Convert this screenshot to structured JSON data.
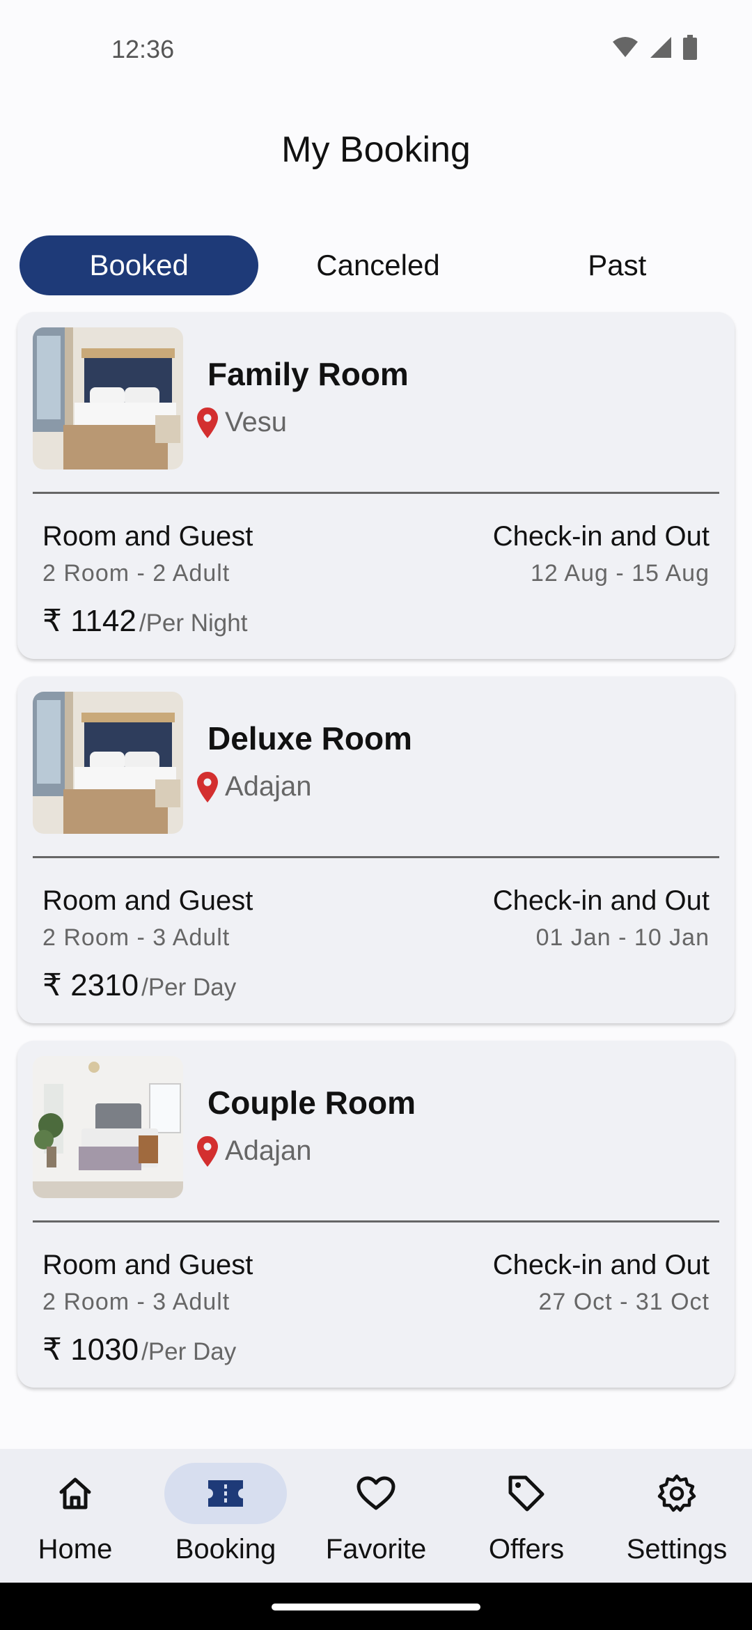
{
  "status": {
    "time": "12:36"
  },
  "header": {
    "title": "My Booking"
  },
  "tabs": [
    {
      "label": "Booked",
      "active": true
    },
    {
      "label": "Canceled",
      "active": false
    },
    {
      "label": "Past",
      "active": false
    }
  ],
  "bookings": [
    {
      "name": "Family Room",
      "location": "Vesu",
      "room_label": "Room and Guest",
      "room_value": "2 Room - 2 Adult",
      "check_label": "Check-in and Out",
      "check_value": "12 Aug - 15 Aug",
      "price": "₹ 1142",
      "price_unit": "/Per Night"
    },
    {
      "name": "Deluxe Room",
      "location": "Adajan",
      "room_label": "Room and Guest",
      "room_value": "2 Room - 3 Adult",
      "check_label": "Check-in and Out",
      "check_value": "01 Jan - 10 Jan",
      "price": "₹ 2310",
      "price_unit": "/Per Day"
    },
    {
      "name": "Couple Room",
      "location": "Adajan",
      "room_label": "Room and Guest",
      "room_value": "2 Room - 3 Adult",
      "check_label": "Check-in and Out",
      "check_value": "27 Oct - 31 Oct",
      "price": "₹ 1030",
      "price_unit": "/Per Day"
    }
  ],
  "nav": [
    {
      "label": "Home",
      "icon": "home-icon",
      "active": false
    },
    {
      "label": "Booking",
      "icon": "ticket-icon",
      "active": true
    },
    {
      "label": "Favorite",
      "icon": "heart-icon",
      "active": false
    },
    {
      "label": "Offers",
      "icon": "tag-icon",
      "active": false
    },
    {
      "label": "Settings",
      "icon": "gear-icon",
      "active": false
    }
  ],
  "colors": {
    "accent": "#1e3a78",
    "nav_active_pill": "#d7deef",
    "pin": "#d32f2f",
    "card_bg": "#f0f1f5"
  }
}
